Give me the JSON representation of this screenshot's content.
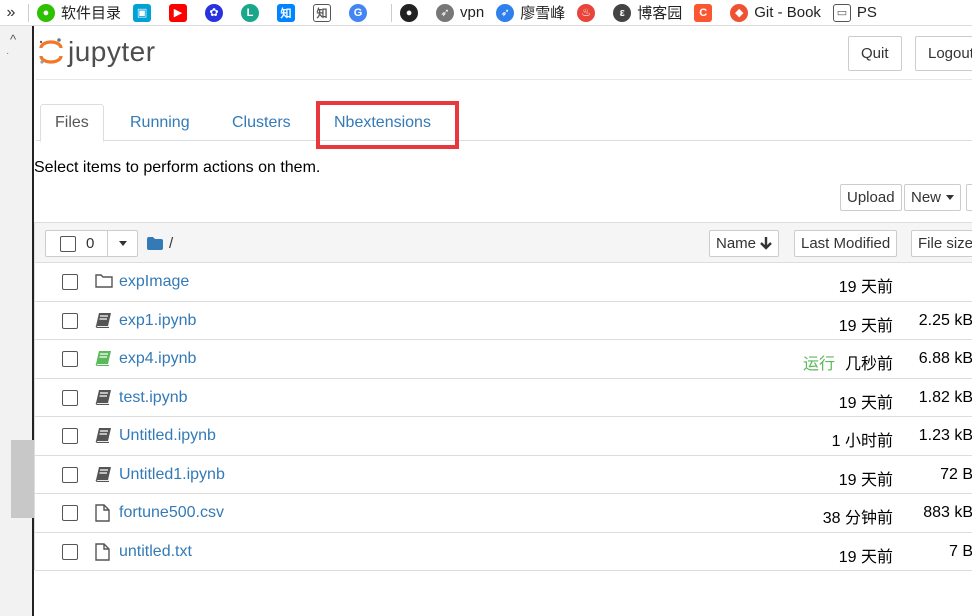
{
  "bookmarks": [
    {
      "label": "软件目录",
      "icon": "wechat-icon",
      "color": "#2dc100"
    },
    {
      "label": "",
      "icon": "bilibili-icon",
      "color": "#00a1d6"
    },
    {
      "label": "",
      "icon": "youtube-icon",
      "color": "#ff0000"
    },
    {
      "label": "",
      "icon": "baidu-icon",
      "color": "#2932e1"
    },
    {
      "label": "",
      "icon": "lofter-icon",
      "color": "#1aa68a"
    },
    {
      "label": "",
      "icon": "zhihu-icon",
      "color": "#0084ff"
    },
    {
      "label": "",
      "icon": "zhi-icon",
      "color": "#333333"
    },
    {
      "label": "",
      "icon": "google-icon",
      "color": "#4285f4"
    },
    {
      "label": "",
      "icon": "github-icon",
      "color": "#222222"
    },
    {
      "label": "vpn",
      "icon": "rocket-icon",
      "color": "#777777"
    },
    {
      "label": "廖雪峰",
      "icon": "rocket-blue-icon",
      "color": "#2f80ed"
    },
    {
      "label": "",
      "icon": "flame-icon",
      "color": "#e8443a"
    },
    {
      "label": "博客园",
      "icon": "cnblogs-icon",
      "color": "#444444"
    },
    {
      "label": "",
      "icon": "csdn-icon",
      "color": "#fc5531"
    },
    {
      "label": "Git - Book",
      "icon": "git-icon",
      "color": "#f05133"
    },
    {
      "label": "PS",
      "icon": "folder-icon",
      "color": "#555555"
    }
  ],
  "header": {
    "logo_text": "jupyter",
    "quit_label": "Quit",
    "logout_label": "Logout"
  },
  "tabs": [
    {
      "label": "Files",
      "active": true
    },
    {
      "label": "Running",
      "active": false
    },
    {
      "label": "Clusters",
      "active": false
    },
    {
      "label": "Nbextensions",
      "active": false,
      "highlighted": true
    }
  ],
  "hint_text": "Select items to perform actions on them.",
  "toolbar": {
    "upload_label": "Upload",
    "new_label": "New"
  },
  "list_header": {
    "selected_count": "0",
    "root_path": "/",
    "sort_name_label": "Name",
    "sort_modified_label": "Last Modified",
    "sort_size_label": "File size"
  },
  "files": [
    {
      "name": "expImage",
      "type": "folder",
      "running": "",
      "modified": "19 天前",
      "size": ""
    },
    {
      "name": "exp1.ipynb",
      "type": "notebook",
      "running": "",
      "modified": "19 天前",
      "size": "2.25 kB"
    },
    {
      "name": "exp4.ipynb",
      "type": "notebook-running",
      "running": "运行",
      "modified": "几秒前",
      "size": "6.88 kB"
    },
    {
      "name": "test.ipynb",
      "type": "notebook",
      "running": "",
      "modified": "19 天前",
      "size": "1.82 kB"
    },
    {
      "name": "Untitled.ipynb",
      "type": "notebook",
      "running": "",
      "modified": "1 小时前",
      "size": "1.23 kB"
    },
    {
      "name": "Untitled1.ipynb",
      "type": "notebook",
      "running": "",
      "modified": "19 天前",
      "size": "72 B"
    },
    {
      "name": "fortune500.csv",
      "type": "file",
      "running": "",
      "modified": "38 分钟前",
      "size": "883 kB"
    },
    {
      "name": "untitled.txt",
      "type": "file",
      "running": "",
      "modified": "19 天前",
      "size": "7 B"
    }
  ],
  "colors": {
    "link": "#337ab7",
    "running": "#5cb85c",
    "highlight": "#e8383d",
    "logo_orange": "#f37726"
  }
}
